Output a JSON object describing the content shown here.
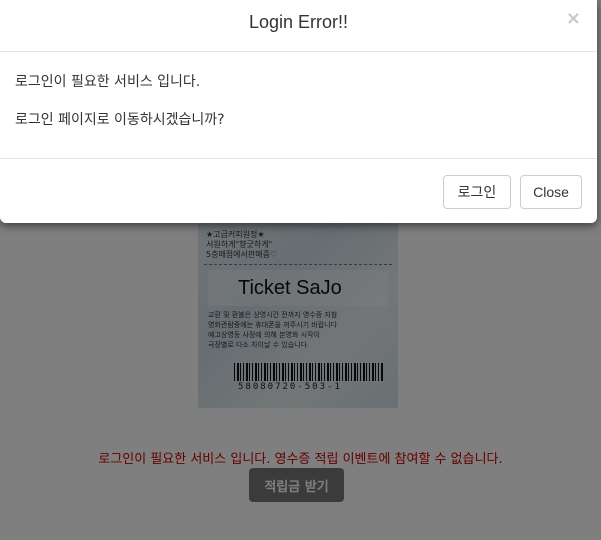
{
  "page": {
    "receipt": {
      "top_text": "★고급커피원정★\n서원하게\"향긋하게\"\n5층매점에서판매중♡",
      "title": "Ticket SaJo",
      "body_text": "교환 및 환불은 상영시간 전까지 영수증 지참\n영화관람중에는 휴대폰을 꺼주시기 바랍니다\n예고상영등 사정에 의해 본영화 시작이\n극장별로 다소 차이날 수 있습니다.",
      "barcode_number": "58080720-503-1"
    },
    "error_message": "로그인이 필요한 서비스 입니다. 영수증 적립 이벤트에 참여할 수 없습니다.",
    "points_button_label": "적립금 받기",
    "error_color": "#cc0000"
  },
  "modal": {
    "title": "Login Error!!",
    "close_icon": "×",
    "body_line1": "로그인이 필요한 서비스 입니다.",
    "body_line2": "로그인 페이지로 이동하시겠습니까?",
    "login_button": "로그인",
    "close_button": "Close"
  }
}
